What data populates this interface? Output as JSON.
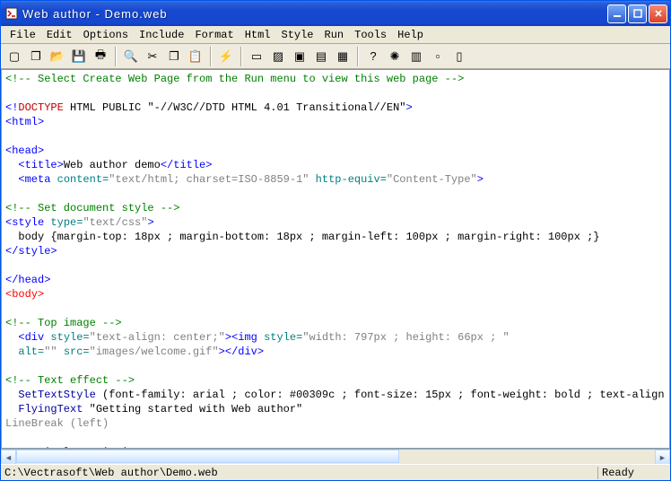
{
  "title": "Web author - Demo.web",
  "menu": [
    "File",
    "Edit",
    "Options",
    "Include",
    "Format",
    "Html",
    "Style",
    "Run",
    "Tools",
    "Help"
  ],
  "toolbar_icons": [
    {
      "n": "new-icon",
      "g": "▢"
    },
    {
      "n": "copy-icon",
      "g": "❐"
    },
    {
      "n": "open-icon",
      "g": "📂"
    },
    {
      "n": "save-icon",
      "g": "💾"
    },
    {
      "n": "print-icon",
      "g": "🖶"
    },
    {
      "n": "sep"
    },
    {
      "n": "binoculars-icon",
      "g": "🔍"
    },
    {
      "n": "cut-icon",
      "g": "✂"
    },
    {
      "n": "copy2-icon",
      "g": "❐"
    },
    {
      "n": "paste-icon",
      "g": "📋"
    },
    {
      "n": "sep"
    },
    {
      "n": "lightning-icon",
      "g": "⚡"
    },
    {
      "n": "sep"
    },
    {
      "n": "page-icon",
      "g": "▭"
    },
    {
      "n": "image-icon",
      "g": "▨"
    },
    {
      "n": "folder-icon",
      "g": "▣"
    },
    {
      "n": "list-icon",
      "g": "▤"
    },
    {
      "n": "check-icon",
      "g": "▦"
    },
    {
      "n": "sep"
    },
    {
      "n": "help-icon",
      "g": "?"
    },
    {
      "n": "gear-icon",
      "g": "✺"
    },
    {
      "n": "window-icon",
      "g": "▥"
    },
    {
      "n": "doc-icon",
      "g": "▫"
    },
    {
      "n": "page2-icon",
      "g": "▯"
    }
  ],
  "code": {
    "l1a": "<!-- Select Create Web Page from the Run menu to view this web page -->",
    "l3a": "<!",
    "l3b": "DOCTYPE",
    "l3c": " HTML PUBLIC \"-//W3C//DTD HTML 4.01 Transitional//EN\"",
    "l3d": ">",
    "l4": "<html>",
    "l6": "<head>",
    "l7a": "  <title>",
    "l7b": "Web author demo",
    "l7c": "</title>",
    "l8a": "  <meta",
    "l8b": " content=",
    "l8c": "\"text/html; charset=ISO-8859-1\"",
    "l8d": " http-equiv=",
    "l8e": "\"Content-Type\"",
    "l8f": ">",
    "l10": "<!-- Set document style -->",
    "l11a": "<style",
    "l11b": " type=",
    "l11c": "\"text/css\"",
    "l11d": ">",
    "l12": "  body {margin-top: 18px ; margin-bottom: 18px ; margin-left: 100px ; margin-right: 100px ;}",
    "l13": "</style>",
    "l15": "</head>",
    "l16": "<body>",
    "l18": "<!-- Top image -->",
    "l19a": "  <div",
    "l19b": " style=",
    "l19c": "\"text-align: center;\"",
    "l19d": "><img",
    "l19e": " style=",
    "l19f": "\"width: 797px ; height: 66px ; \"",
    "l20a": "  alt=",
    "l20b": "\"\"",
    "l20c": " src=",
    "l20d": "\"images/welcome.gif\"",
    "l20e": "></div>",
    "l22": "<!-- Text effect -->",
    "l23a": "  SetTextStyle",
    "l23b": " (font-family: arial ; color: #00309c ; font-size: 15px ; font-weight: bold ; text-align",
    "l24a": "  FlyingText",
    "l24b": " \"Getting started with Web author\"",
    "l25a": "LineBreak",
    "l25b": " (left)",
    "l27": "<!-- Display main image -->"
  },
  "status": {
    "path": "C:\\Vectrasoft\\Web author\\Demo.web",
    "ready": "Ready"
  }
}
